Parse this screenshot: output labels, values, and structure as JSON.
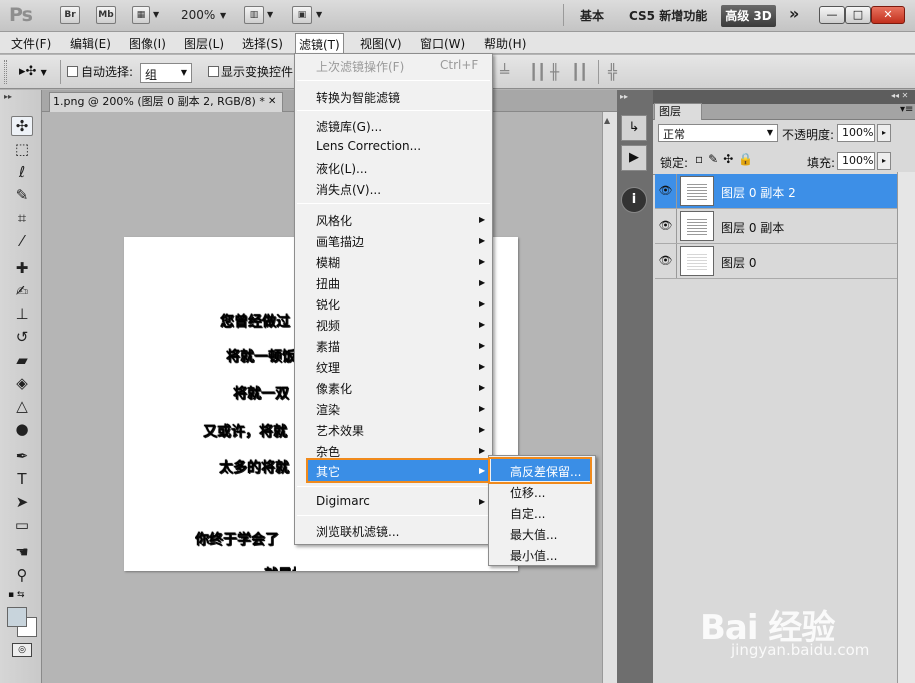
{
  "titlebar": {
    "logo": "Ps",
    "bridge": "Br",
    "minibridge": "Mb",
    "zoom": "200%",
    "workspaces": [
      "基本",
      "CS5 新增功能"
    ],
    "active_workspace": "高级 3D",
    "more": "»",
    "win_min": "—",
    "win_max": "□",
    "win_close": "✕"
  },
  "menubar": {
    "items": [
      "文件(F)",
      "编辑(E)",
      "图像(I)",
      "图层(L)",
      "选择(S)",
      "滤镜(T)",
      "视图(V)",
      "窗口(W)",
      "帮助(H)"
    ],
    "open_index": 5
  },
  "options": {
    "auto_select_label": "自动选择:",
    "auto_select_value": "组",
    "show_transform_label": "显示变换控件"
  },
  "document": {
    "tab_title": "1.png @ 200% (图层 0 副本 2, RGB/8) *",
    "tab_close": "✕",
    "lines": [
      "您曾经做过",
      "将就一顿饭",
      "将就一双",
      "又或许，将就",
      "太多的将就",
      "你终于学会了",
      "就是把人放在"
    ]
  },
  "filter_menu": {
    "last_filter": "上次滤镜操作(F)",
    "last_filter_shortcut": "Ctrl+F",
    "smart": "转换为智能滤镜",
    "group_a": [
      "滤镜库(G)...",
      "Lens Correction...",
      "液化(L)...",
      "消失点(V)..."
    ],
    "group_b": [
      "风格化",
      "画笔描边",
      "模糊",
      "扭曲",
      "锐化",
      "视频",
      "素描",
      "纹理",
      "像素化",
      "渲染",
      "艺术效果",
      "杂色",
      "其它"
    ],
    "highlighted": "其它",
    "digimarc": "Digimarc",
    "browse": "浏览联机滤镜..."
  },
  "sub_menu": {
    "items": [
      "高反差保留...",
      "位移...",
      "自定...",
      "最大值...",
      "最小值..."
    ],
    "highlighted": "高反差保留..."
  },
  "layers_panel": {
    "tab": "图层",
    "blend_mode": "正常",
    "opacity_label": "不透明度:",
    "opacity": "100%",
    "lock_label": "锁定:",
    "fill_label": "填充:",
    "fill": "100%",
    "layers": [
      {
        "name": "图层 0 副本 2",
        "selected": true
      },
      {
        "name": "图层 0 副本",
        "selected": false
      },
      {
        "name": "图层 0",
        "selected": false
      }
    ]
  },
  "watermark": {
    "brand": "Bai 经验",
    "url": "jingyan.baidu.com"
  },
  "colors": {
    "highlight": "#3a8ee6",
    "callout": "#f08a1c",
    "layer_selected": "#3d8fe7"
  }
}
